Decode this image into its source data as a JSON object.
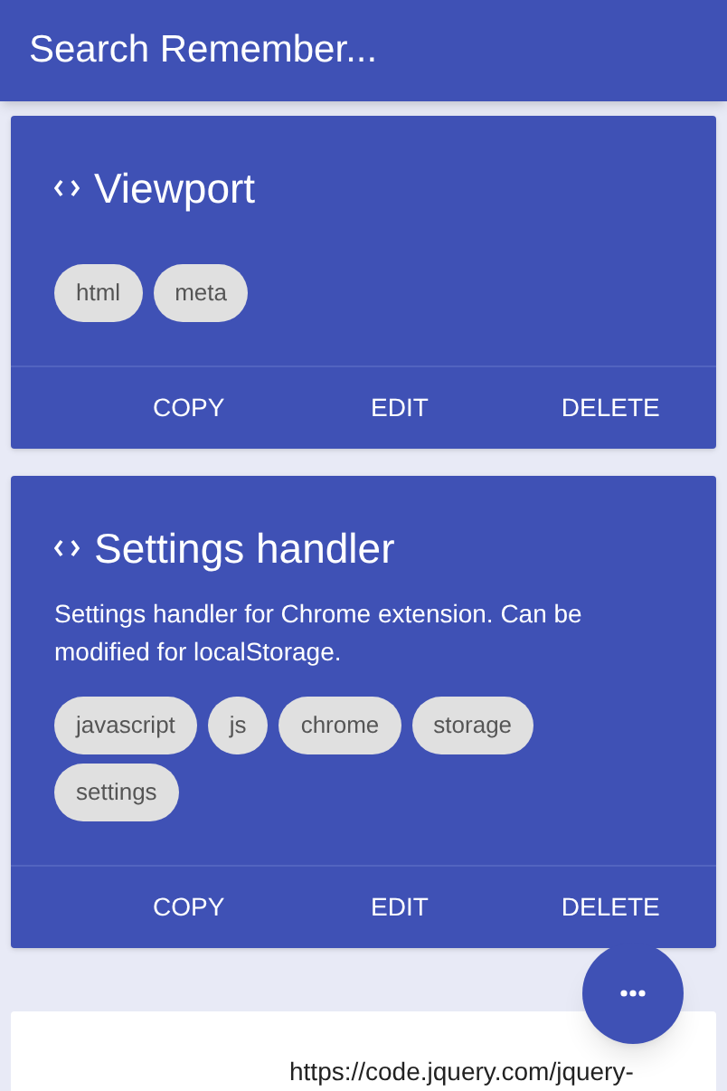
{
  "app_bar": {
    "title": "Search Remember..."
  },
  "cards": [
    {
      "kind": "snippet",
      "title": "Viewport",
      "tags": [
        "html",
        "meta"
      ],
      "actions": [
        "COPY",
        "EDIT",
        "DELETE"
      ]
    },
    {
      "kind": "snippet",
      "title": "Settings handler",
      "description": "Settings handler for Chrome extension. Can be modified for localStorage.",
      "tags": [
        "javascript",
        "js",
        "chrome",
        "storage",
        "settings"
      ],
      "actions": [
        "COPY",
        "EDIT",
        "DELETE"
      ]
    },
    {
      "kind": "code",
      "text": "https://code.jquery.com/jquery-"
    }
  ]
}
